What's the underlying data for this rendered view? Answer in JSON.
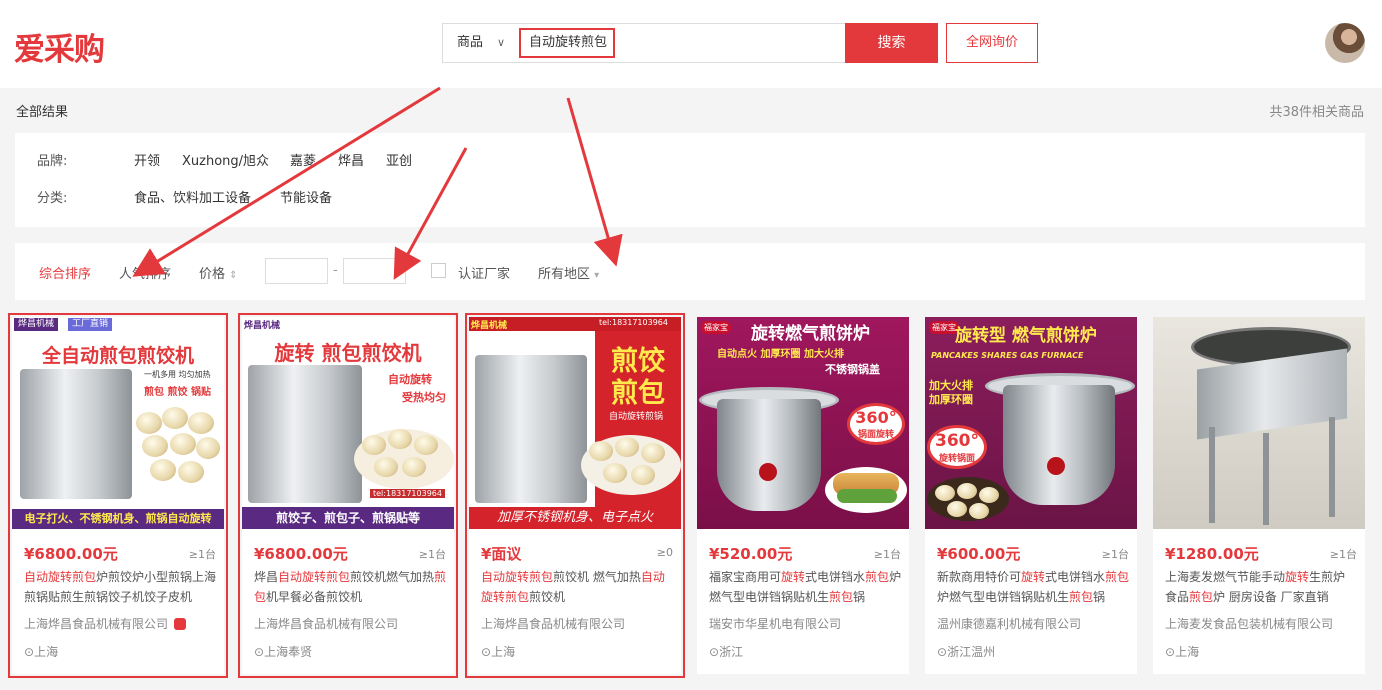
{
  "header": {
    "logo": "爱采购",
    "search_type": "商品",
    "search_value": "自动旋转煎包",
    "search_button": "搜索",
    "inquiry_button": "全网询价"
  },
  "results": {
    "crumb": "全部结果",
    "total": "共38件相关商品"
  },
  "filters": {
    "brand_label": "品牌:",
    "brands": [
      "开领",
      "Xuzhong/旭众",
      "嘉菱",
      "烨昌",
      "亚创"
    ],
    "category_label": "分类:",
    "categories": [
      "食品、饮料加工设备",
      "节能设备"
    ]
  },
  "sort": {
    "comprehensive": "综合排序",
    "popularity": "人气排序",
    "price": "价格",
    "price_arrow": "⇕",
    "dash": "-",
    "verified": "认证厂家",
    "region": "所有地区",
    "region_arrow": "▾"
  },
  "products": [
    {
      "price": "¥6800.00元",
      "qty": "≥1台",
      "title_parts": [
        {
          "t": "自动旋转煎包",
          "kw": true
        },
        {
          "t": "炉煎饺炉小型煎锅上海煎锅贴煎生煎锅饺子机饺子皮机",
          "kw": false
        }
      ],
      "company": "上海烨昌食品机械有限公司",
      "location": "上海",
      "art": {
        "brand": "烨昌机械",
        "tag": "工厂直销",
        "headline": "全自动煎包煎饺机",
        "sub": "一机多用 均匀加热",
        "sub2": "煎包 煎饺 锅贴",
        "footer": "电子打火、不锈钢机身、煎锅自动旋转"
      }
    },
    {
      "price": "¥6800.00元",
      "qty": "≥1台",
      "title_parts": [
        {
          "t": "烨昌",
          "kw": false
        },
        {
          "t": "自动旋转煎包",
          "kw": true
        },
        {
          "t": "煎饺机燃气加热",
          "kw": false
        },
        {
          "t": "煎包",
          "kw": true
        },
        {
          "t": "机早餐必备煎饺机",
          "kw": false
        }
      ],
      "company": "上海烨昌食品机械有限公司",
      "location": "上海奉贤",
      "art": {
        "brand": "烨昌机械",
        "headline": "旋转 煎包煎饺机",
        "sub": "自动旋转",
        "sub2": "受热均匀",
        "phone": "tel:18317103964",
        "footer": "煎饺子、煎包子、煎锅贴等"
      }
    },
    {
      "price": "¥面议",
      "qty": "≥0",
      "title_parts": [
        {
          "t": "自动旋转煎包",
          "kw": true
        },
        {
          "t": "煎饺机 燃气加热",
          "kw": false
        },
        {
          "t": "自动旋转煎包",
          "kw": true
        },
        {
          "t": "煎饺机",
          "kw": false
        }
      ],
      "company": "上海烨昌食品机械有限公司",
      "location": "上海",
      "art": {
        "brand": "烨昌机械",
        "phone": "tel:18317103964",
        "headline": "煎饺",
        "headline2": "煎包",
        "sub": "自动旋转煎锅",
        "footer": "加厚不锈钢机身、电子点火"
      }
    },
    {
      "price": "¥520.00元",
      "qty": "≥1台",
      "title_parts": [
        {
          "t": "福家宝商用可",
          "kw": false
        },
        {
          "t": "旋转",
          "kw": true
        },
        {
          "t": "式电饼铛水",
          "kw": false
        },
        {
          "t": "煎包",
          "kw": true
        },
        {
          "t": "炉燃气型电饼铛锅贴机生",
          "kw": false
        },
        {
          "t": "煎包",
          "kw": true
        },
        {
          "t": "锅",
          "kw": false
        }
      ],
      "company": "瑞安市华星机电有限公司",
      "location": "浙江",
      "art": {
        "brand": "福家宝",
        "headline": "旋转燃气煎饼炉",
        "sub": "自动点火 加厚环圈 加大火排",
        "sub2": "不锈钢锅盖",
        "burst": "360°",
        "burst2": "锅面旋转"
      }
    },
    {
      "price": "¥600.00元",
      "qty": "≥1台",
      "title_parts": [
        {
          "t": "新款商用特价可",
          "kw": false
        },
        {
          "t": "旋转",
          "kw": true
        },
        {
          "t": "式电饼铛水",
          "kw": false
        },
        {
          "t": "煎包",
          "kw": true
        },
        {
          "t": "炉燃气型电饼铛锅贴机生",
          "kw": false
        },
        {
          "t": "煎包",
          "kw": true
        },
        {
          "t": "锅",
          "kw": false
        }
      ],
      "company": "温州康德嘉利机械有限公司",
      "location": "浙江温州",
      "art": {
        "brand": "福家宝",
        "headline": "旋转型 燃气煎饼炉",
        "sub": "PANCAKES SHARES GAS FURNACE",
        "sub2": "加大火排 加厚环圈",
        "burst": "360°",
        "burst2": "旋转锅面"
      }
    },
    {
      "price": "¥1280.00元",
      "qty": "≥1台",
      "title_parts": [
        {
          "t": "上海麦发燃气节能手动",
          "kw": false
        },
        {
          "t": "旋转",
          "kw": true
        },
        {
          "t": "生煎炉 食品",
          "kw": false
        },
        {
          "t": "煎包",
          "kw": true
        },
        {
          "t": "炉 厨房设备 厂家直销",
          "kw": false
        }
      ],
      "company": "上海麦发食品包装机械有限公司",
      "location": "上海",
      "art": {}
    }
  ],
  "colors": {
    "accent": "#e4393c",
    "banner_purple": "#5a2a82",
    "page_bg": "#f4f4f4"
  }
}
